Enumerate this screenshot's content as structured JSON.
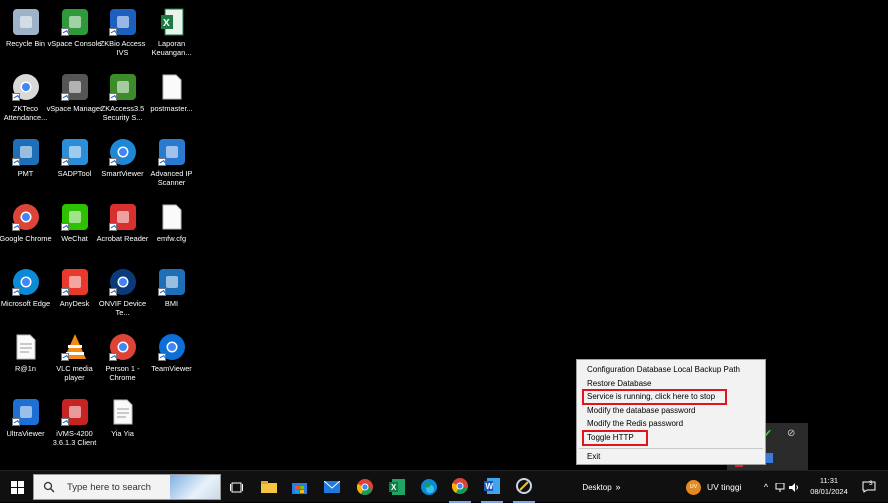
{
  "desktop": {
    "icons": [
      {
        "label": "Recycle Bin",
        "icon": "recycle-bin-icon"
      },
      {
        "label": "vSpace Console",
        "icon": "vspace-console-icon"
      },
      {
        "label": "ZKBio Access IVS",
        "icon": "zkbio-access-icon"
      },
      {
        "label": "Laporan Keuangan...",
        "icon": "excel-file-icon"
      },
      {
        "label": "ZKTeco Attendance...",
        "icon": "zkteco-clock-icon"
      },
      {
        "label": "vSpace Manager",
        "icon": "vspace-manager-icon"
      },
      {
        "label": "ZKAccess3.5 Security S...",
        "icon": "zkaccess-icon"
      },
      {
        "label": "postmaster...",
        "icon": "blank-file-icon"
      },
      {
        "label": "PMT",
        "icon": "pmt-icon"
      },
      {
        "label": "SADPTool",
        "icon": "sadptool-icon"
      },
      {
        "label": "SmartViewer",
        "icon": "smartviewer-icon"
      },
      {
        "label": "Advanced IP Scanner",
        "icon": "ip-scanner-icon"
      },
      {
        "label": "Google Chrome",
        "icon": "chrome-icon"
      },
      {
        "label": "WeChat",
        "icon": "wechat-icon"
      },
      {
        "label": "Acrobat Reader",
        "icon": "acrobat-icon"
      },
      {
        "label": "emfw.cfg",
        "icon": "blank-file-icon"
      },
      {
        "label": "Microsoft Edge",
        "icon": "edge-icon"
      },
      {
        "label": "AnyDesk",
        "icon": "anydesk-icon"
      },
      {
        "label": "ONVIF Device Te...",
        "icon": "onvif-icon"
      },
      {
        "label": "BMI",
        "icon": "bmi-icon"
      },
      {
        "label": "R@1n",
        "icon": "text-file-icon"
      },
      {
        "label": "VLC media player",
        "icon": "vlc-icon"
      },
      {
        "label": "Person 1 - Chrome",
        "icon": "chrome-profile-icon"
      },
      {
        "label": "TeamViewer",
        "icon": "teamviewer-icon"
      },
      {
        "label": "UltraViewer",
        "icon": "ultraviewer-icon"
      },
      {
        "label": "iVMS-4200 3.6.1.3 Client",
        "icon": "ivms-icon"
      },
      {
        "label": "Yia Yia",
        "icon": "text-file-icon"
      }
    ]
  },
  "context_menu": {
    "items": [
      "Configuration Database Local Backup Path",
      "Restore Database",
      "Service is running, click here to stop",
      "Modify the database password",
      "Modify the Redis password",
      "Toggle HTTP",
      "Exit"
    ],
    "highlighted": [
      "Service is running, click here to stop",
      "Toggle HTTP"
    ],
    "highlight_color": "#e3131b"
  },
  "taskbar": {
    "start_icon": "windows-logo-icon",
    "search_placeholder": "Type here to search",
    "pinned": [
      "task-view-icon",
      "file-explorer-icon",
      "store-icon",
      "mail-icon",
      "chrome-icon",
      "excel-icon",
      "edge-icon",
      "chrome-icon",
      "word-icon",
      "vlc-pinned-icon"
    ],
    "desktop_label": "Desktop",
    "weather_badge": "UV",
    "weather_text": "UV tinggi",
    "clock_time": "11:31",
    "clock_date": "08/01/2024",
    "notification_count": "3"
  }
}
